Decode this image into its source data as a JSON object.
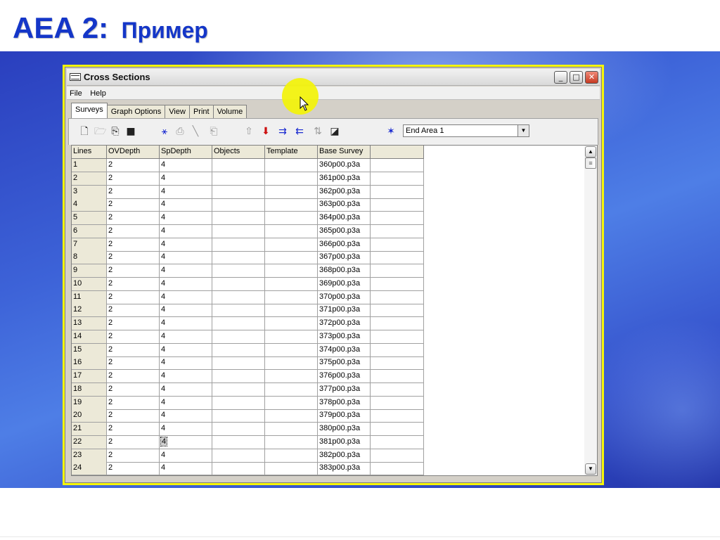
{
  "slide": {
    "title_main": "AEA 2:",
    "title_sub": "Пример"
  },
  "window": {
    "title": "Cross  Sections",
    "controls": {
      "minimize": "_",
      "maximize": "□",
      "close": "✕"
    }
  },
  "menu": {
    "file": "File",
    "help": "Help"
  },
  "tabs": [
    "Surveys",
    "Graph Options",
    "View",
    "Print",
    "Volume"
  ],
  "toolbar": {
    "icons": [
      "new-icon",
      "open-icon",
      "copy-icon",
      "save-icon",
      "network-icon",
      "paste-icon",
      "draw-line-icon",
      "export-icon",
      "arrow-up-icon",
      "arrow-down-icon",
      "insert-right-icon",
      "insert-left-icon",
      "sort-icon",
      "zoom-icon",
      "area-tool-icon"
    ],
    "area_select": {
      "value": "End Area 1"
    }
  },
  "grid": {
    "columns": [
      "Lines",
      "OVDepth",
      "SpDepth",
      "Objects",
      "Template",
      "Base Survey",
      ""
    ],
    "rows": [
      [
        "1",
        "2",
        "4",
        "",
        "",
        "360p00.p3a",
        ""
      ],
      [
        "2",
        "2",
        "4",
        "",
        "",
        "361p00.p3a",
        ""
      ],
      [
        "3",
        "2",
        "4",
        "",
        "",
        "362p00.p3a",
        ""
      ],
      [
        "4",
        "2",
        "4",
        "",
        "",
        "363p00.p3a",
        ""
      ],
      [
        "5",
        "2",
        "4",
        "",
        "",
        "364p00.p3a",
        ""
      ],
      [
        "6",
        "2",
        "4",
        "",
        "",
        "365p00.p3a",
        ""
      ],
      [
        "7",
        "2",
        "4",
        "",
        "",
        "366p00.p3a",
        ""
      ],
      [
        "8",
        "2",
        "4",
        "",
        "",
        "367p00.p3a",
        ""
      ],
      [
        "9",
        "2",
        "4",
        "",
        "",
        "368p00.p3a",
        ""
      ],
      [
        "10",
        "2",
        "4",
        "",
        "",
        "369p00.p3a",
        ""
      ],
      [
        "11",
        "2",
        "4",
        "",
        "",
        "370p00.p3a",
        ""
      ],
      [
        "12",
        "2",
        "4",
        "",
        "",
        "371p00.p3a",
        ""
      ],
      [
        "13",
        "2",
        "4",
        "",
        "",
        "372p00.p3a",
        ""
      ],
      [
        "14",
        "2",
        "4",
        "",
        "",
        "373p00.p3a",
        ""
      ],
      [
        "15",
        "2",
        "4",
        "",
        "",
        "374p00.p3a",
        ""
      ],
      [
        "16",
        "2",
        "4",
        "",
        "",
        "375p00.p3a",
        ""
      ],
      [
        "17",
        "2",
        "4",
        "",
        "",
        "376p00.p3a",
        ""
      ],
      [
        "18",
        "2",
        "4",
        "",
        "",
        "377p00.p3a",
        ""
      ],
      [
        "19",
        "2",
        "4",
        "",
        "",
        "378p00.p3a",
        ""
      ],
      [
        "20",
        "2",
        "4",
        "",
        "",
        "379p00.p3a",
        ""
      ],
      [
        "21",
        "2",
        "4",
        "",
        "",
        "380p00.p3a",
        ""
      ],
      [
        "22",
        "2",
        "4",
        "",
        "",
        "381p00.p3a",
        ""
      ],
      [
        "23",
        "2",
        "4",
        "",
        "",
        "382p00.p3a",
        ""
      ],
      [
        "24",
        "2",
        "4",
        "",
        "",
        "383p00.p3a",
        ""
      ]
    ],
    "selected_cell": {
      "row": 22,
      "column": "SpDepth"
    }
  },
  "colors": {
    "title_blue": "#1436c8",
    "highlight_yellow": "#f2f20e",
    "frame_yellow": "#f5f50a"
  }
}
